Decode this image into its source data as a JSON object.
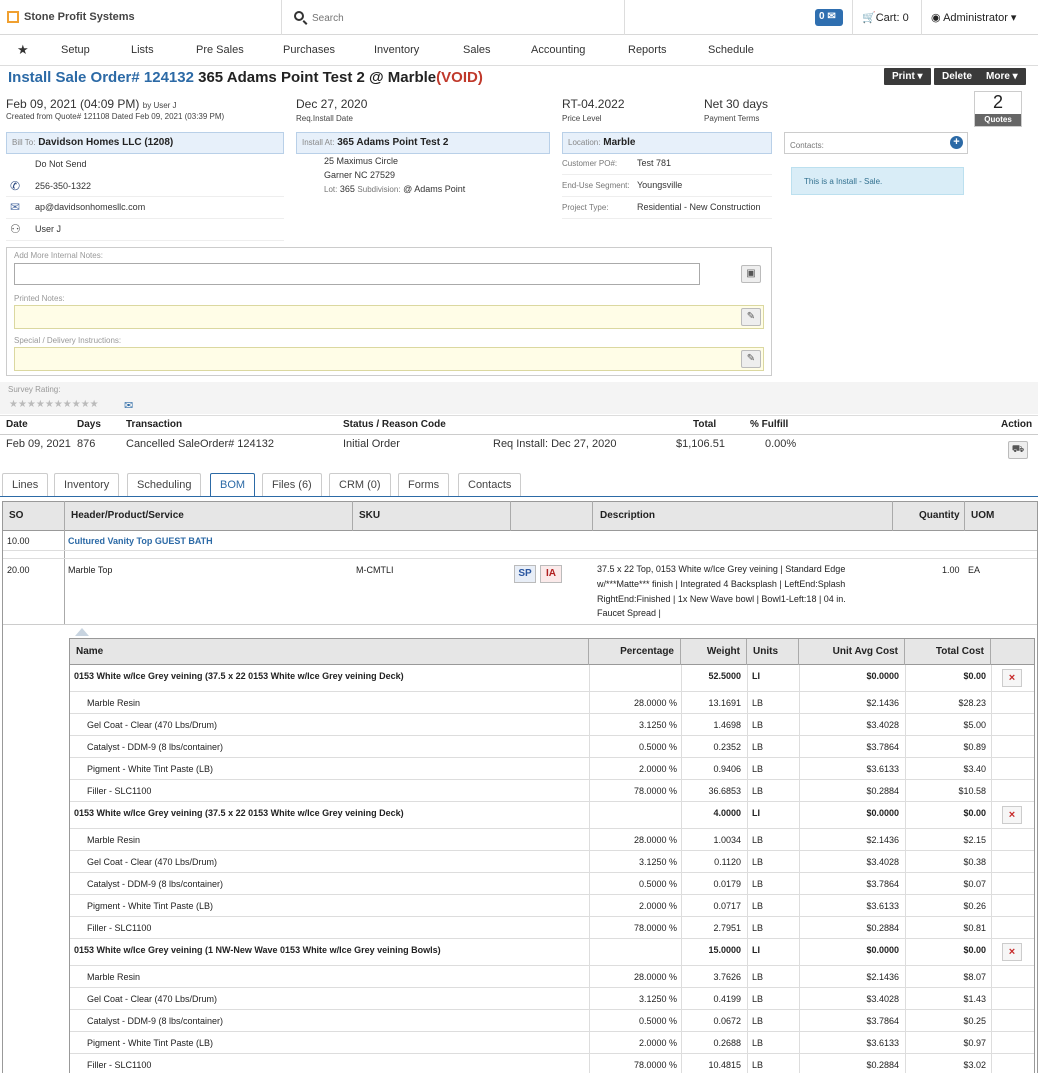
{
  "app": {
    "name": "Stone Profit Systems"
  },
  "search": {
    "placeholder": "Search"
  },
  "header": {
    "mail_count": "0",
    "cart_label": "Cart: 0",
    "user_label": "Administrator"
  },
  "nav": [
    "Setup",
    "Lists",
    "Pre Sales",
    "Purchases",
    "Inventory",
    "Sales",
    "Accounting",
    "Reports",
    "Schedule"
  ],
  "order": {
    "title_prefix": "Install Sale Order# 124132",
    "title_main": " 365 Adams Point Test 2 @ Marble",
    "title_status": "(VOID)",
    "buttons": {
      "print": "Print",
      "delete": "Delete",
      "more": "More"
    },
    "date_line": "Feb 09, 2021 (04:09 PM)",
    "by_user": "by User J",
    "created_from": "Created from Quote# 121108 Dated Feb 09, 2021 (03:39 PM)",
    "req_date": "Dec 27, 2020",
    "req_date_label": "Req.Install Date",
    "price_level": "RT-04.2022",
    "price_level_label": "Price Level",
    "payment_terms": "Net 30 days",
    "payment_terms_label": "Payment Terms",
    "quotes_count": "2",
    "quotes_label": "Quotes"
  },
  "billto": {
    "label": "Bill To:",
    "name": "Davidson Homes LLC (1208)",
    "do_not_send": "Do Not Send",
    "phone": "256-350-1322",
    "email": "ap@davidsonhomesllc.com",
    "rep": "User J"
  },
  "install": {
    "label": "Install At:",
    "name": "365 Adams Point Test 2",
    "addr1": "25 Maximus Circle",
    "addr2": "Garner NC 27529",
    "lot_label": "Lot:",
    "lot": "365",
    "subdiv_label": "Subdivision:",
    "subdiv": "@ Adams Point"
  },
  "location": {
    "label": "Location:",
    "name": "Marble",
    "po_label": "Customer PO#:",
    "po": "Test 781",
    "segment_label": "End-Use Segment:",
    "segment": "Youngsville",
    "project_label": "Project Type:",
    "project": "Residential - New Construction"
  },
  "contacts": {
    "label": "Contacts:",
    "info": "This is a Install - Sale."
  },
  "notes": {
    "internal_label": "Add More Internal Notes:",
    "printed_label": "Printed Notes:",
    "special_label": "Special / Delivery Instructions:"
  },
  "survey": {
    "label": "Survey Rating:"
  },
  "history": {
    "headers": [
      "Date",
      "Days",
      "Transaction",
      "Status / Reason Code",
      "Total",
      "% Fulfill",
      "Action"
    ],
    "row": {
      "date": "Feb 09, 2021",
      "days": "876",
      "transaction": "Cancelled SaleOrder# 124132",
      "status": "Initial Order",
      "req": "Req Install: Dec 27, 2020",
      "total": "$1,106.51",
      "fulfill": "0.00%"
    }
  },
  "tabs": [
    "Lines",
    "Inventory",
    "Scheduling",
    "BOM",
    "Files (6)",
    "CRM (0)",
    "Forms",
    "Contacts"
  ],
  "bom": {
    "headers": [
      "SO",
      "Header/Product/Service",
      "SKU",
      "",
      "Description",
      "Quantity",
      "UOM"
    ],
    "header_row": {
      "so": "10.00",
      "name": "Cultured Vanity Top GUEST BATH"
    },
    "item": {
      "so": "20.00",
      "name": "Marble Top",
      "sku": "M-CMTLI",
      "sp": "SP",
      "ia": "IA",
      "desc1": "37.5 x 22 Top, 0153 White w/Ice Grey veining | Standard Edge",
      "desc2": "w/***Matte*** finish | Integrated 4 Backsplash | LeftEnd:Splash",
      "desc3": "RightEnd:Finished | 1x New Wave bowl | Bowl1-Left:18 | 04 in.",
      "desc4": "Faucet Spread |",
      "qty": "1.00",
      "uom": "EA"
    },
    "sub_headers": [
      "Name",
      "Percentage",
      "Weight",
      "Units",
      "Unit Avg Cost",
      "Total Cost"
    ],
    "groups": [
      {
        "name": "0153 White w/Ice Grey veining (37.5 x 22 0153 White w/Ice Grey veining Deck)",
        "weight": "52.5000",
        "units": "LI",
        "unit_cost": "$0.0000",
        "total": "$0.00",
        "rows": [
          {
            "name": "Marble Resin",
            "pct": "28.0000 %",
            "weight": "13.1691",
            "units": "LB",
            "unit_cost": "$2.1436",
            "total": "$28.23"
          },
          {
            "name": "Gel Coat - Clear (470 Lbs/Drum)",
            "pct": "3.1250 %",
            "weight": "1.4698",
            "units": "LB",
            "unit_cost": "$3.4028",
            "total": "$5.00"
          },
          {
            "name": "Catalyst - DDM-9 (8 lbs/container)",
            "pct": "0.5000 %",
            "weight": "0.2352",
            "units": "LB",
            "unit_cost": "$3.7864",
            "total": "$0.89"
          },
          {
            "name": "Pigment - White Tint Paste (LB)",
            "pct": "2.0000 %",
            "weight": "0.9406",
            "units": "LB",
            "unit_cost": "$3.6133",
            "total": "$3.40"
          },
          {
            "name": "Filler - SLC1100",
            "pct": "78.0000 %",
            "weight": "36.6853",
            "units": "LB",
            "unit_cost": "$0.2884",
            "total": "$10.58"
          }
        ]
      },
      {
        "name": "0153 White w/Ice Grey veining (37.5 x 22 0153 White w/Ice Grey veining Deck)",
        "weight": "4.0000",
        "units": "LI",
        "unit_cost": "$0.0000",
        "total": "$0.00",
        "rows": [
          {
            "name": "Marble Resin",
            "pct": "28.0000 %",
            "weight": "1.0034",
            "units": "LB",
            "unit_cost": "$2.1436",
            "total": "$2.15"
          },
          {
            "name": "Gel Coat - Clear (470 Lbs/Drum)",
            "pct": "3.1250 %",
            "weight": "0.1120",
            "units": "LB",
            "unit_cost": "$3.4028",
            "total": "$0.38"
          },
          {
            "name": "Catalyst - DDM-9 (8 lbs/container)",
            "pct": "0.5000 %",
            "weight": "0.0179",
            "units": "LB",
            "unit_cost": "$3.7864",
            "total": "$0.07"
          },
          {
            "name": "Pigment - White Tint Paste (LB)",
            "pct": "2.0000 %",
            "weight": "0.0717",
            "units": "LB",
            "unit_cost": "$3.6133",
            "total": "$0.26"
          },
          {
            "name": "Filler - SLC1100",
            "pct": "78.0000 %",
            "weight": "2.7951",
            "units": "LB",
            "unit_cost": "$0.2884",
            "total": "$0.81"
          }
        ]
      },
      {
        "name": "0153 White w/Ice Grey veining (1 NW-New Wave 0153 White w/Ice Grey veining Bowls)",
        "weight": "15.0000",
        "units": "LI",
        "unit_cost": "$0.0000",
        "total": "$0.00",
        "rows": [
          {
            "name": "Marble Resin",
            "pct": "28.0000 %",
            "weight": "3.7626",
            "units": "LB",
            "unit_cost": "$2.1436",
            "total": "$8.07"
          },
          {
            "name": "Gel Coat - Clear (470 Lbs/Drum)",
            "pct": "3.1250 %",
            "weight": "0.4199",
            "units": "LB",
            "unit_cost": "$3.4028",
            "total": "$1.43"
          },
          {
            "name": "Catalyst - DDM-9 (8 lbs/container)",
            "pct": "0.5000 %",
            "weight": "0.0672",
            "units": "LB",
            "unit_cost": "$3.7864",
            "total": "$0.25"
          },
          {
            "name": "Pigment - White Tint Paste (LB)",
            "pct": "2.0000 %",
            "weight": "0.2688",
            "units": "LB",
            "unit_cost": "$3.6133",
            "total": "$0.97"
          },
          {
            "name": "Filler - SLC1100",
            "pct": "78.0000 %",
            "weight": "10.4815",
            "units": "LB",
            "unit_cost": "$0.2884",
            "total": "$3.02"
          }
        ]
      }
    ]
  }
}
